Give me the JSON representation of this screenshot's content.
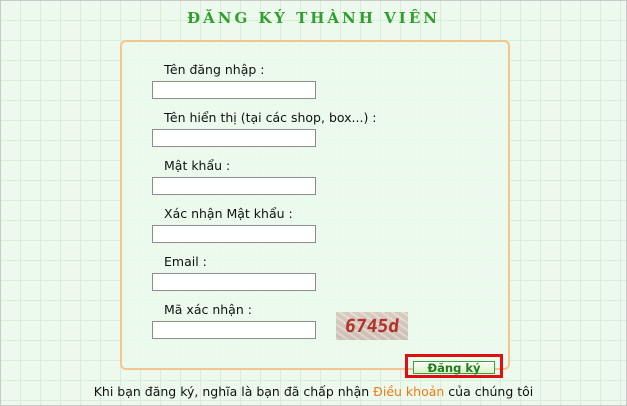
{
  "page": {
    "title": "ĐĂNG KÝ THÀNH VIÊN"
  },
  "form": {
    "username": {
      "label": "Tên đăng nhập :",
      "value": ""
    },
    "display_name": {
      "label": "Tên hiển thị (tại các shop, box...) :",
      "value": ""
    },
    "password": {
      "label": "Mật khẩu :",
      "value": ""
    },
    "confirm_password": {
      "label": "Xác nhận Mật khẩu :",
      "value": ""
    },
    "email": {
      "label": "Email :",
      "value": ""
    },
    "captcha": {
      "label": "Mã xác nhận :",
      "value": "",
      "code": "6745d"
    },
    "submit_label": "Đăng ký"
  },
  "footer": {
    "text_before": "Khi bạn đăng ký, nghĩa là bạn đã chấp nhận ",
    "terms_link": "Điều khoản",
    "text_after": " của chúng tôi"
  },
  "colors": {
    "title": "#2fa02f",
    "form_border": "#f6c48f",
    "highlight": "#e01010",
    "link": "#f07a10"
  }
}
